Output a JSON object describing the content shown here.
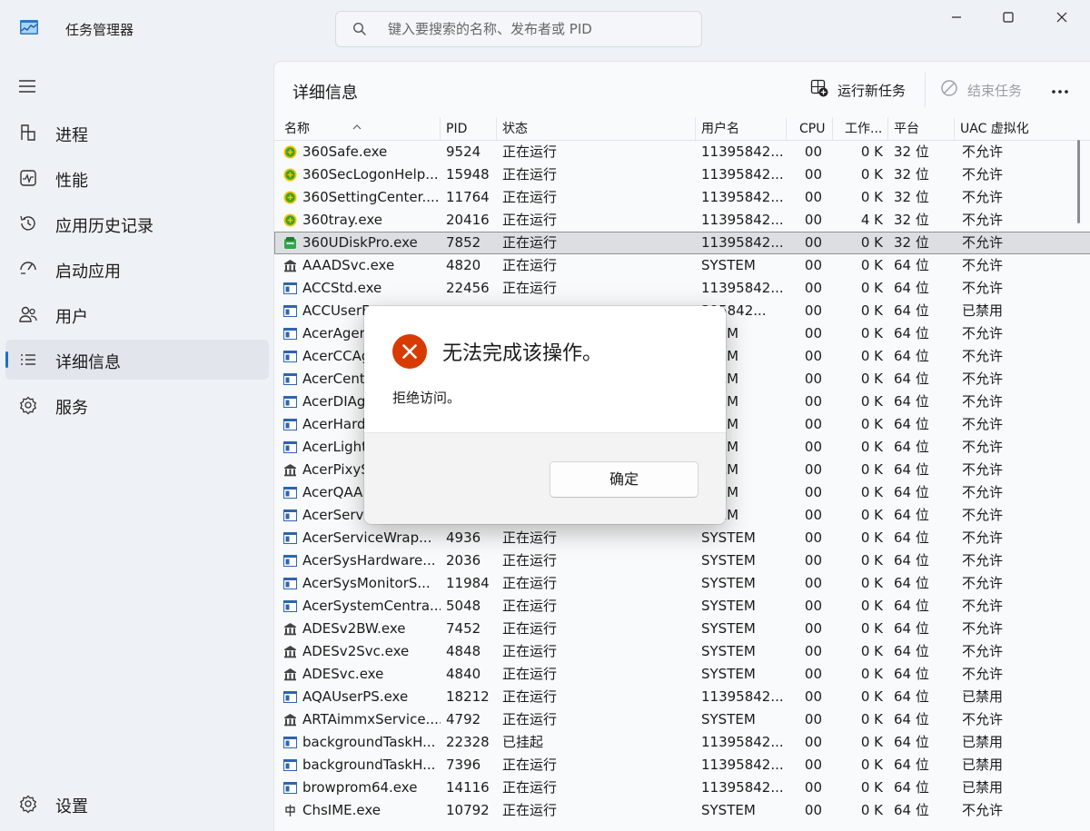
{
  "app": {
    "title": "任务管理器"
  },
  "search": {
    "placeholder": "键入要搜索的名称、发布者或 PID"
  },
  "window_controls": [
    "minimize-icon",
    "maximize-icon",
    "close-icon"
  ],
  "sidebar": {
    "items": [
      {
        "label": "进程",
        "icon": "processes-icon"
      },
      {
        "label": "性能",
        "icon": "performance-icon"
      },
      {
        "label": "应用历史记录",
        "icon": "app-history-icon"
      },
      {
        "label": "启动应用",
        "icon": "startup-apps-icon"
      },
      {
        "label": "用户",
        "icon": "users-icon"
      },
      {
        "label": "详细信息",
        "icon": "details-icon",
        "active": true
      },
      {
        "label": "服务",
        "icon": "services-icon"
      }
    ],
    "settings_label": "设置"
  },
  "main": {
    "title": "详细信息",
    "run_new_task": "运行新任务",
    "end_task": "结束任务"
  },
  "table": {
    "columns": [
      "名称",
      "PID",
      "状态",
      "用户名",
      "CPU",
      "工作...",
      "平台",
      "UAC 虚拟化"
    ],
    "rows": [
      {
        "icon": "360",
        "name": "360Safe.exe",
        "pid": "9524",
        "status": "正在运行",
        "user": "11395842...",
        "cpu": "00",
        "mem": "0 K",
        "platform": "32 位",
        "uac": "不允许"
      },
      {
        "icon": "360",
        "name": "360SecLogonHelp...",
        "pid": "15948",
        "status": "正在运行",
        "user": "11395842...",
        "cpu": "00",
        "mem": "0 K",
        "platform": "32 位",
        "uac": "不允许"
      },
      {
        "icon": "360",
        "name": "360SettingCenter....",
        "pid": "11764",
        "status": "正在运行",
        "user": "11395842...",
        "cpu": "00",
        "mem": "0 K",
        "platform": "32 位",
        "uac": "不允许"
      },
      {
        "icon": "360",
        "name": "360tray.exe",
        "pid": "20416",
        "status": "正在运行",
        "user": "11395842...",
        "cpu": "00",
        "mem": "4 K",
        "platform": "32 位",
        "uac": "不允许"
      },
      {
        "icon": "udisk",
        "name": "360UDiskPro.exe",
        "pid": "7852",
        "status": "正在运行",
        "user": "11395842...",
        "cpu": "00",
        "mem": "0 K",
        "platform": "32 位",
        "uac": "不允许",
        "selected": true
      },
      {
        "icon": "service",
        "name": "AAADSvc.exe",
        "pid": "4820",
        "status": "正在运行",
        "user": "SYSTEM",
        "cpu": "00",
        "mem": "0 K",
        "platform": "64 位",
        "uac": "不允许"
      },
      {
        "icon": "window",
        "name": "ACCStd.exe",
        "pid": "22456",
        "status": "正在运行",
        "user": "11395842...",
        "cpu": "00",
        "mem": "0 K",
        "platform": "64 位",
        "uac": "不允许"
      },
      {
        "icon": "window",
        "name": "ACCUserF",
        "pid": "",
        "status": "",
        "user": "395842...",
        "cpu": "00",
        "mem": "0 K",
        "platform": "64 位",
        "uac": "已禁用"
      },
      {
        "icon": "window",
        "name": "AcerAger",
        "pid": "",
        "status": "",
        "user": "STEM",
        "cpu": "00",
        "mem": "0 K",
        "platform": "64 位",
        "uac": "不允许"
      },
      {
        "icon": "window",
        "name": "AcerCCAg",
        "pid": "",
        "status": "",
        "user": "STEM",
        "cpu": "00",
        "mem": "0 K",
        "platform": "64 位",
        "uac": "不允许"
      },
      {
        "icon": "window",
        "name": "AcerCent",
        "pid": "",
        "status": "",
        "user": "STEM",
        "cpu": "00",
        "mem": "0 K",
        "platform": "64 位",
        "uac": "不允许"
      },
      {
        "icon": "window",
        "name": "AcerDIAg",
        "pid": "",
        "status": "",
        "user": "STEM",
        "cpu": "00",
        "mem": "0 K",
        "platform": "64 位",
        "uac": "不允许"
      },
      {
        "icon": "window",
        "name": "AcerHard",
        "pid": "",
        "status": "",
        "user": "STEM",
        "cpu": "00",
        "mem": "0 K",
        "platform": "64 位",
        "uac": "不允许"
      },
      {
        "icon": "window",
        "name": "AcerLight",
        "pid": "",
        "status": "",
        "user": "STEM",
        "cpu": "00",
        "mem": "0 K",
        "platform": "64 位",
        "uac": "不允许"
      },
      {
        "icon": "service",
        "name": "AcerPixyS",
        "pid": "",
        "status": "",
        "user": "STEM",
        "cpu": "00",
        "mem": "0 K",
        "platform": "64 位",
        "uac": "不允许"
      },
      {
        "icon": "window",
        "name": "AcerQAA",
        "pid": "",
        "status": "",
        "user": "STEM",
        "cpu": "00",
        "mem": "0 K",
        "platform": "64 位",
        "uac": "不允许"
      },
      {
        "icon": "window",
        "name": "AcerServi",
        "pid": "",
        "status": "",
        "user": "STEM",
        "cpu": "00",
        "mem": "0 K",
        "platform": "64 位",
        "uac": "不允许"
      },
      {
        "icon": "window",
        "name": "AcerServiceWrap...",
        "pid": "4936",
        "status": "正在运行",
        "user": "SYSTEM",
        "cpu": "00",
        "mem": "0 K",
        "platform": "64 位",
        "uac": "不允许"
      },
      {
        "icon": "window",
        "name": "AcerSysHardware...",
        "pid": "2036",
        "status": "正在运行",
        "user": "SYSTEM",
        "cpu": "00",
        "mem": "0 K",
        "platform": "64 位",
        "uac": "不允许"
      },
      {
        "icon": "window",
        "name": "AcerSysMonitorS...",
        "pid": "11984",
        "status": "正在运行",
        "user": "SYSTEM",
        "cpu": "00",
        "mem": "0 K",
        "platform": "64 位",
        "uac": "不允许"
      },
      {
        "icon": "window",
        "name": "AcerSystemCentra...",
        "pid": "5048",
        "status": "正在运行",
        "user": "SYSTEM",
        "cpu": "00",
        "mem": "0 K",
        "platform": "64 位",
        "uac": "不允许"
      },
      {
        "icon": "service",
        "name": "ADESv2BW.exe",
        "pid": "7452",
        "status": "正在运行",
        "user": "SYSTEM",
        "cpu": "00",
        "mem": "0 K",
        "platform": "64 位",
        "uac": "不允许"
      },
      {
        "icon": "service",
        "name": "ADESv2Svc.exe",
        "pid": "4848",
        "status": "正在运行",
        "user": "SYSTEM",
        "cpu": "00",
        "mem": "0 K",
        "platform": "64 位",
        "uac": "不允许"
      },
      {
        "icon": "service",
        "name": "ADESvc.exe",
        "pid": "4840",
        "status": "正在运行",
        "user": "SYSTEM",
        "cpu": "00",
        "mem": "0 K",
        "platform": "64 位",
        "uac": "不允许"
      },
      {
        "icon": "window",
        "name": "AQAUserPS.exe",
        "pid": "18212",
        "status": "正在运行",
        "user": "11395842...",
        "cpu": "00",
        "mem": "0 K",
        "platform": "64 位",
        "uac": "已禁用"
      },
      {
        "icon": "service",
        "name": "ARTAimmxService....",
        "pid": "4792",
        "status": "正在运行",
        "user": "SYSTEM",
        "cpu": "00",
        "mem": "0 K",
        "platform": "64 位",
        "uac": "不允许"
      },
      {
        "icon": "window",
        "name": "backgroundTaskH...",
        "pid": "22328",
        "status": "已挂起",
        "user": "11395842...",
        "cpu": "00",
        "mem": "0 K",
        "platform": "64 位",
        "uac": "已禁用"
      },
      {
        "icon": "window",
        "name": "backgroundTaskH...",
        "pid": "7396",
        "status": "正在运行",
        "user": "11395842...",
        "cpu": "00",
        "mem": "0 K",
        "platform": "64 位",
        "uac": "已禁用"
      },
      {
        "icon": "window",
        "name": "browprom64.exe",
        "pid": "14116",
        "status": "正在运行",
        "user": "11395842...",
        "cpu": "00",
        "mem": "0 K",
        "platform": "64 位",
        "uac": "已禁用"
      },
      {
        "icon": "ime",
        "name": "ChsIME.exe",
        "pid": "10792",
        "status": "正在运行",
        "user": "SYSTEM",
        "cpu": "00",
        "mem": "0 K",
        "platform": "64 位",
        "uac": "不允许"
      }
    ]
  },
  "dialog": {
    "title": "无法完成该操作。",
    "message": "拒绝访问。",
    "ok_label": "确定",
    "icon": "error-icon"
  },
  "colors": {
    "accent": "#1d6fc8",
    "error": "#d83b01",
    "background": "#eef1f5",
    "panel": "#f9fafb"
  }
}
